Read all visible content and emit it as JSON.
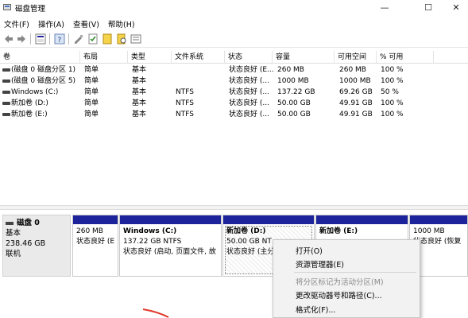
{
  "window": {
    "title": "磁盘管理",
    "controls": {
      "minimize": "—",
      "maximize": "☐",
      "close": "✕"
    }
  },
  "menubar": [
    "文件(F)",
    "操作(A)",
    "查看(V)",
    "帮助(H)"
  ],
  "toolbar_icons": [
    "back-icon",
    "forward-icon",
    "disk-view-icon",
    "help-icon",
    "properties-icon",
    "check-icon",
    "new-volume-icon",
    "search-icon",
    "list-icon"
  ],
  "volume_list": {
    "columns": [
      "卷",
      "布局",
      "类型",
      "文件系统",
      "状态",
      "容量",
      "可用空间",
      "% 可用"
    ],
    "rows": [
      [
        "(磁盘 0 磁盘分区 1)",
        "简单",
        "基本",
        "",
        "状态良好 (E...",
        "260 MB",
        "260 MB",
        "100 %"
      ],
      [
        "(磁盘 0 磁盘分区 5)",
        "简单",
        "基本",
        "",
        "状态良好 (...",
        "1000 MB",
        "1000 MB",
        "100 %"
      ],
      [
        "Windows (C:)",
        "简单",
        "基本",
        "NTFS",
        "状态良好 (...",
        "137.22 GB",
        "69.26 GB",
        "50 %"
      ],
      [
        "新加卷 (D:)",
        "简单",
        "基本",
        "NTFS",
        "状态良好 (...",
        "50.00 GB",
        "49.91 GB",
        "100 %"
      ],
      [
        "新加卷 (E:)",
        "简单",
        "基本",
        "NTFS",
        "状态良好 (...",
        "50.00 GB",
        "49.91 GB",
        "100 %"
      ]
    ]
  },
  "disk": {
    "name": "磁盘 0",
    "type": "基本",
    "size": "238.46 GB",
    "status": "联机"
  },
  "partitions": [
    {
      "name": "",
      "line1": "260 MB",
      "line2": "状态良好 (E"
    },
    {
      "name": "Windows (C:)",
      "line1": "137.22 GB NTFS",
      "line2": "状态良好 (启动, 页面文件, 故"
    },
    {
      "name": "新加卷 (D:)",
      "line1": "50.00 GB NT",
      "line2": "状态良好 (主分"
    },
    {
      "name": "新加卷 (E:)",
      "line1": "",
      "line2": ""
    },
    {
      "name": "",
      "line1": "1000 MB",
      "line2": "状态良好 (恢复"
    }
  ],
  "context_menu": {
    "items": [
      {
        "label": "打开(O)",
        "disabled": false
      },
      {
        "label": "资源管理器(E)",
        "disabled": false
      },
      {
        "label": "将分区标记为活动分区(M)",
        "disabled": true
      },
      {
        "label": "更改驱动器号和路径(C)...",
        "disabled": false
      },
      {
        "label": "格式化(F)...",
        "disabled": false
      }
    ]
  },
  "colors": {
    "partition_bar": "#1d239a",
    "menu_bg": "#f2f2f2",
    "arrow": "#e03a2b"
  }
}
